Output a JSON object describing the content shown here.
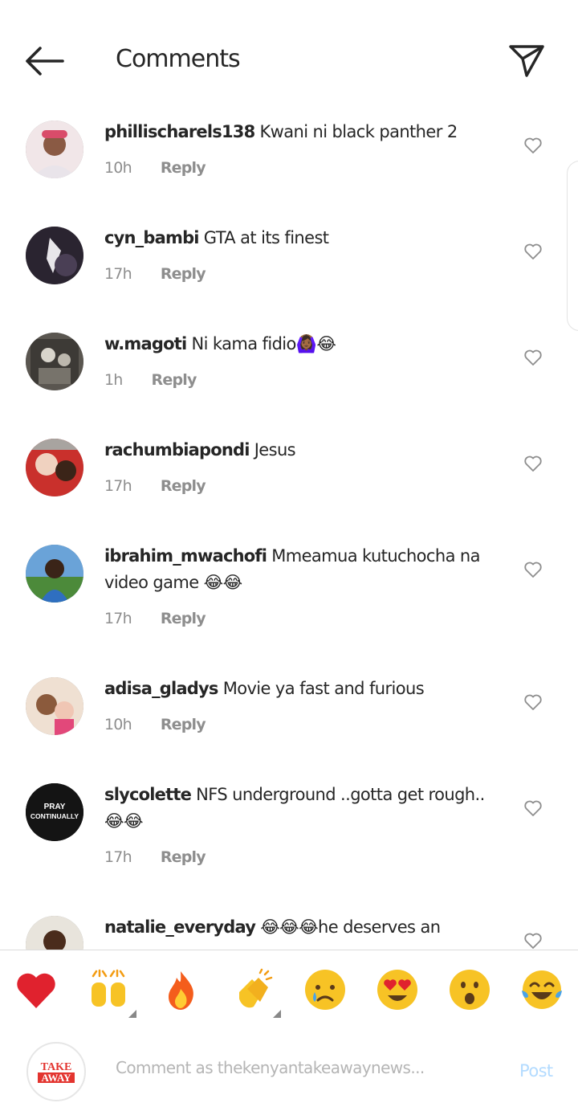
{
  "header": {
    "title": "Comments"
  },
  "comments": [
    {
      "username": "phillischarels138",
      "text": "Kwani ni black panther 2",
      "time": "10h",
      "reply_label": "Reply"
    },
    {
      "username": "cyn_bambi",
      "text": "GTA at its finest",
      "time": "17h",
      "reply_label": "Reply"
    },
    {
      "username": "w.magoti",
      "text": "Ni kama fidio🙆🏾‍♀️😂",
      "time": "1h",
      "reply_label": "Reply"
    },
    {
      "username": "rachumbiapondi",
      "text": "Jesus",
      "time": "17h",
      "reply_label": "Reply"
    },
    {
      "username": "ibrahim_mwachofi",
      "text": "Mmeamua kutuchocha na video game 😂😂",
      "time": "17h",
      "reply_label": "Reply"
    },
    {
      "username": "adisa_gladys",
      "text": "Movie ya fast and furious",
      "time": "10h",
      "reply_label": "Reply"
    },
    {
      "username": "slycolette",
      "text": "NFS underground ..gotta get rough..😂😂",
      "time": "17h",
      "reply_label": "Reply"
    },
    {
      "username": "natalie_everyday",
      "text": "😂😂😂he deserves an",
      "time": "",
      "reply_label": ""
    }
  ],
  "avatars": {
    "slycolette_line1": "PRAY",
    "slycolette_line2": "CONTINUALLY"
  },
  "quick_reactions": [
    "❤️",
    "🙌",
    "🔥",
    "👏",
    "😢",
    "😍",
    "😮",
    "😂"
  ],
  "composer": {
    "placeholder": "Comment as thekenyantakeawaynews...",
    "post_label": "Post",
    "logo_line1": "TAKE",
    "logo_line2": "AWAY"
  },
  "colors": {
    "username": "#262626",
    "meta": "#8e8e8e",
    "post_disabled": "#b3dbff",
    "logo_red": "#e3342f"
  }
}
